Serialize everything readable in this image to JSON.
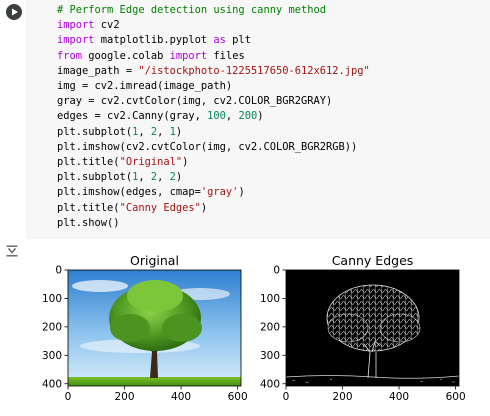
{
  "cell": {
    "run_icon": "play-icon",
    "lines": [
      [
        {
          "t": "# Perform Edge detection using canny method",
          "c": "cm"
        }
      ],
      [
        {
          "t": "import",
          "c": "kw"
        },
        {
          "t": " cv2"
        }
      ],
      [
        {
          "t": "import",
          "c": "kw"
        },
        {
          "t": " matplotlib.pyplot "
        },
        {
          "t": "as",
          "c": "kw"
        },
        {
          "t": " plt"
        }
      ],
      [
        {
          "t": "from",
          "c": "kw"
        },
        {
          "t": " google.colab "
        },
        {
          "t": "import",
          "c": "kw"
        },
        {
          "t": " files"
        }
      ],
      [
        {
          "t": "image_path = "
        },
        {
          "t": "\"/istockphoto-1225517650-612x612.jpg\"",
          "c": "st"
        }
      ],
      [
        {
          "t": "img = cv2.imread(image_path)"
        }
      ],
      [
        {
          "t": "gray = cv2.cvtColor(img, cv2.COLOR_BGR2GRAY)"
        }
      ],
      [
        {
          "t": "edges = cv2.Canny(gray, "
        },
        {
          "t": "100",
          "c": "nu"
        },
        {
          "t": ", "
        },
        {
          "t": "200",
          "c": "nu"
        },
        {
          "t": ")"
        }
      ],
      [
        {
          "t": "plt.subplot("
        },
        {
          "t": "1",
          "c": "nu"
        },
        {
          "t": ", "
        },
        {
          "t": "2",
          "c": "nu"
        },
        {
          "t": ", "
        },
        {
          "t": "1",
          "c": "nu"
        },
        {
          "t": ")"
        }
      ],
      [
        {
          "t": "plt.imshow(cv2.cvtColor(img, cv2.COLOR_BGR2RGB))"
        }
      ],
      [
        {
          "t": "plt.title("
        },
        {
          "t": "\"Original\"",
          "c": "st"
        },
        {
          "t": ")"
        }
      ],
      [
        {
          "t": "plt.subplot("
        },
        {
          "t": "1",
          "c": "nu"
        },
        {
          "t": ", "
        },
        {
          "t": "2",
          "c": "nu"
        },
        {
          "t": ", "
        },
        {
          "t": "2",
          "c": "nu"
        },
        {
          "t": ")"
        }
      ],
      [
        {
          "t": "plt.imshow(edges, cmap="
        },
        {
          "t": "'gray'",
          "c": "st"
        },
        {
          "t": ")"
        }
      ],
      [
        {
          "t": "plt.title("
        },
        {
          "t": "\"Canny Edges\"",
          "c": "st"
        },
        {
          "t": ")"
        }
      ],
      [
        {
          "t": "plt.show()"
        }
      ]
    ]
  },
  "output": {
    "icon": "output-toggle-icon",
    "plots": [
      {
        "title": "Original",
        "kind": "photo-tree",
        "xticks": [
          0,
          200,
          400,
          600
        ],
        "yticks": [
          0,
          100,
          200,
          300,
          400
        ],
        "xlim": [
          0,
          612
        ],
        "ylim": [
          408,
          0
        ]
      },
      {
        "title": "Canny Edges",
        "kind": "edge-tree",
        "xticks": [
          0,
          200,
          400,
          600
        ],
        "yticks": [
          0,
          100,
          200,
          300,
          400
        ],
        "xlim": [
          0,
          612
        ],
        "ylim": [
          408,
          0
        ]
      }
    ]
  }
}
